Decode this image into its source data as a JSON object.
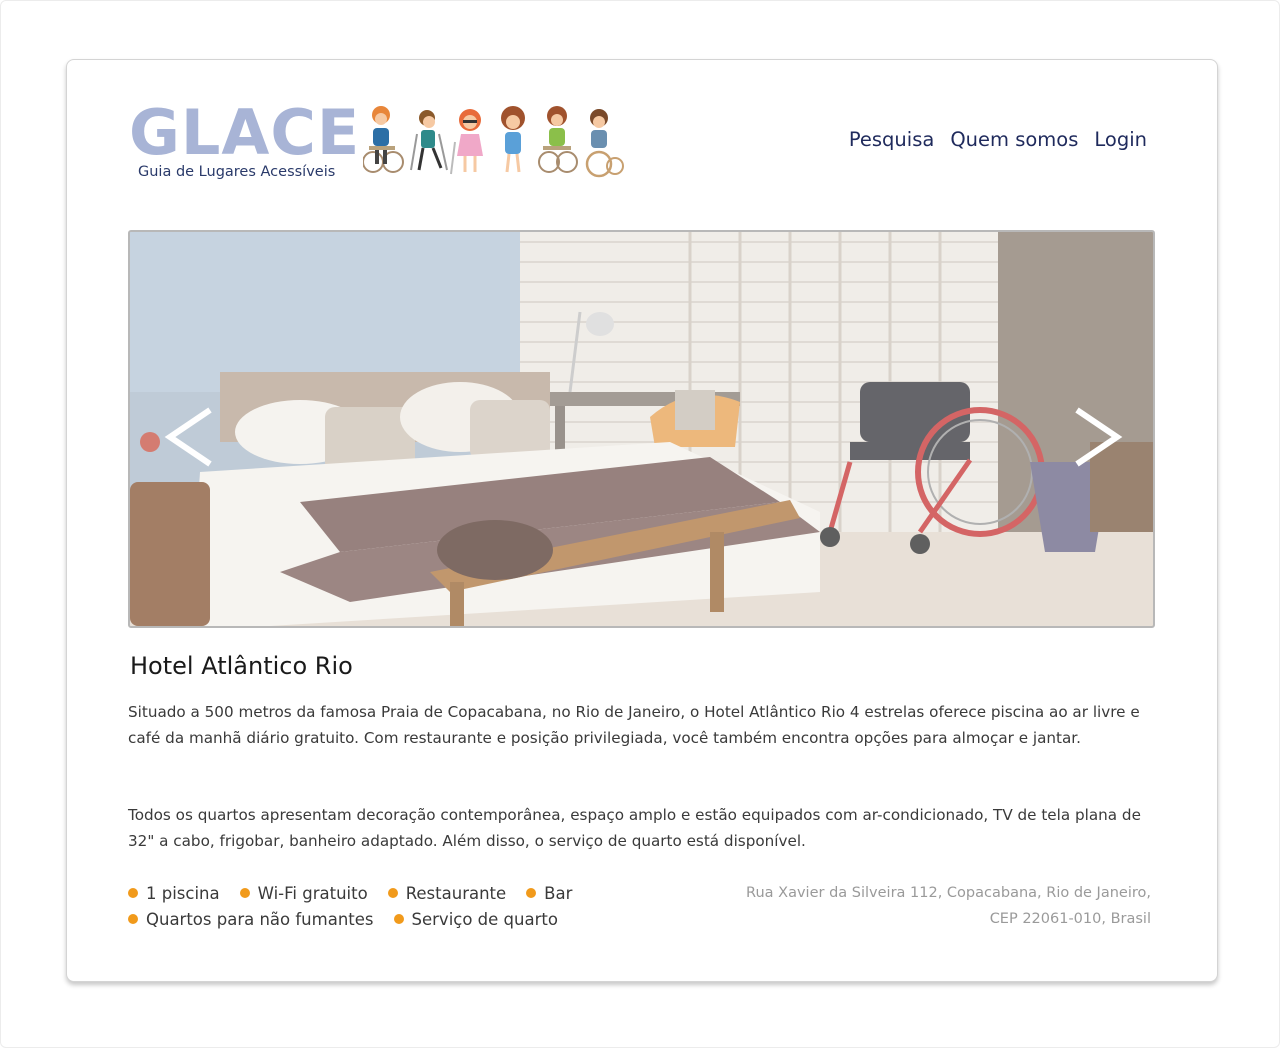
{
  "header": {
    "logo_word": "GLACE",
    "logo_subtitle": "Guia de Lugares Acessíveis",
    "nav": [
      "Pesquisa",
      "Quem somos",
      "Login"
    ]
  },
  "carousel": {
    "prev_icon": "chevron-left-icon",
    "next_icon": "chevron-right-icon"
  },
  "hotel": {
    "name": "Hotel Atlântico Rio",
    "description": [
      "Situado a 500 metros da famosa Praia de Copacabana, no Rio de Janeiro, o Hotel Atlântico Rio 4 estrelas oferece piscina ao ar livre e café da manhã diário gratuito. Com restaurante e posição privilegiada, você também encontra opções para almoçar e jantar.",
      "Todos os quartos apresentam decoração contemporânea, espaço amplo e estão equipados com ar-condicionado, TV de tela plana de 32\" a cabo, frigobar, banheiro adaptado. Além disso, o serviço de quarto está disponível."
    ],
    "amenities": {
      "row1": [
        "1 piscina",
        "Wi-Fi gratuito",
        "Restaurante",
        "Bar"
      ],
      "row2": [
        "Quartos para não fumantes",
        "Serviço de quarto"
      ]
    },
    "address": {
      "line1": "Rua Xavier da Silveira 112, Copacabana, Rio de Janeiro,",
      "line2": "CEP 22061-010, Brasil"
    }
  },
  "colors": {
    "logo": "#a8b4d6",
    "nav": "#1f2a5c",
    "bullet": "#f19a1b",
    "address": "#9a9a9a"
  }
}
